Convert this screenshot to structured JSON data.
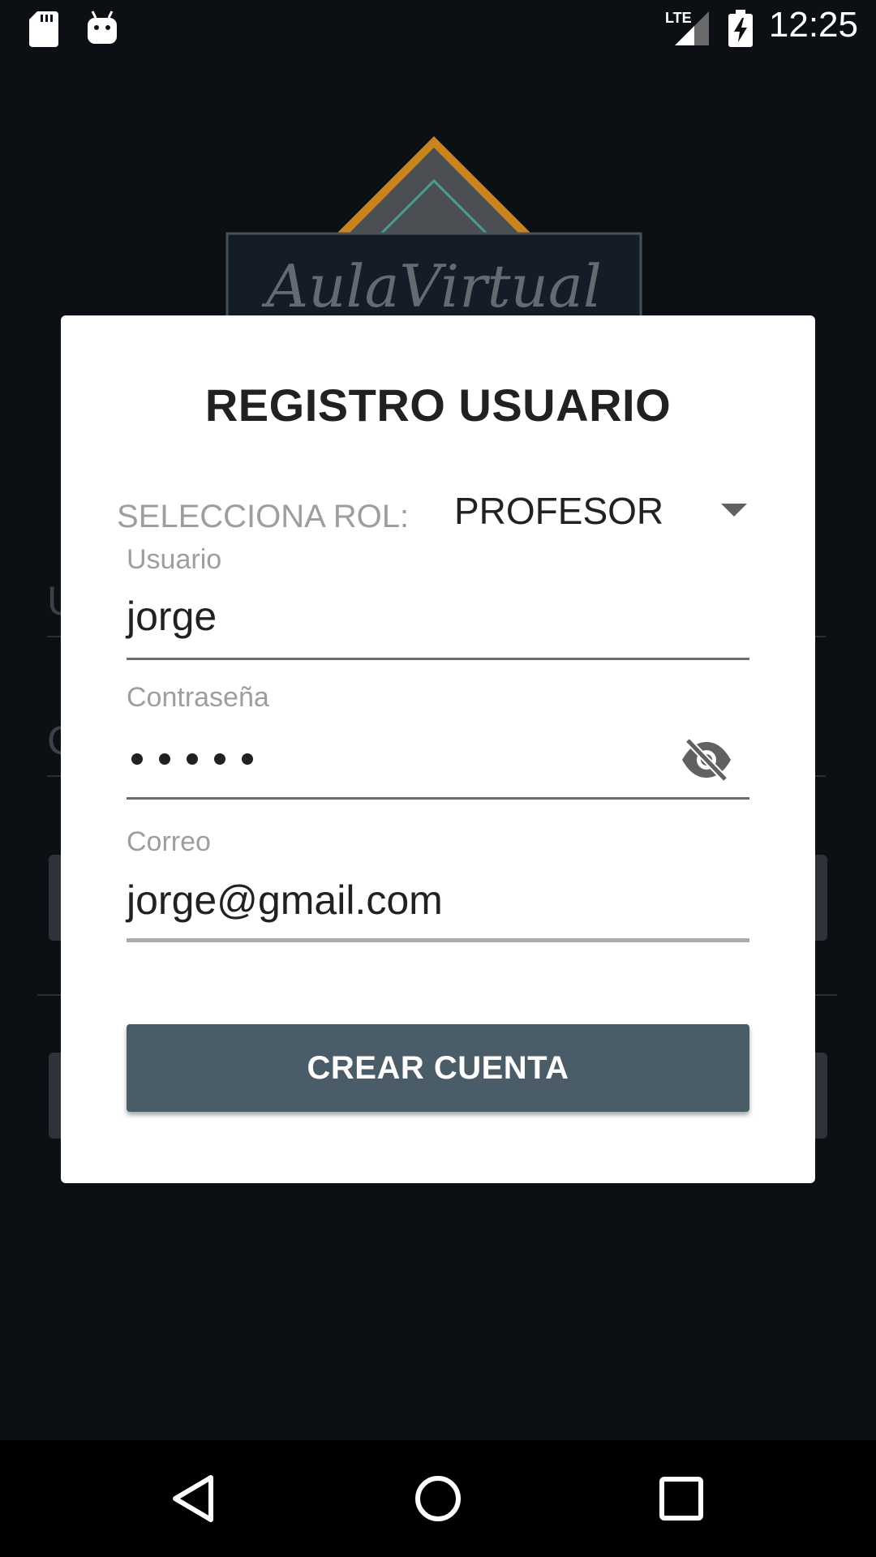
{
  "status_bar": {
    "time": "12:25",
    "network": "LTE",
    "icons": [
      "sd-card-icon",
      "android-icon",
      "lte-signal-icon",
      "battery-charging-icon"
    ]
  },
  "background": {
    "logo_text": "AulaVirtual",
    "field1_initial": "U",
    "field2_initial": "C"
  },
  "dialog": {
    "title": "REGISTRO USUARIO",
    "role_label": "SELECCIONA ROL:",
    "role_value": "PROFESOR",
    "usuario_label": "Usuario",
    "usuario_value": "jorge",
    "password_label": "Contraseña",
    "password_length": 5,
    "correo_label": "Correo",
    "correo_value": "jorge@gmail.com",
    "button_label": "CREAR CUENTA"
  },
  "colors": {
    "background": "#0c1014",
    "dialog": "#ffffff",
    "button": "#4a5c67",
    "logo_orange": "#c8841e",
    "logo_teal": "#4a9c8c"
  },
  "nav_bar": {
    "buttons": [
      "back-icon",
      "home-icon",
      "recents-icon"
    ]
  }
}
